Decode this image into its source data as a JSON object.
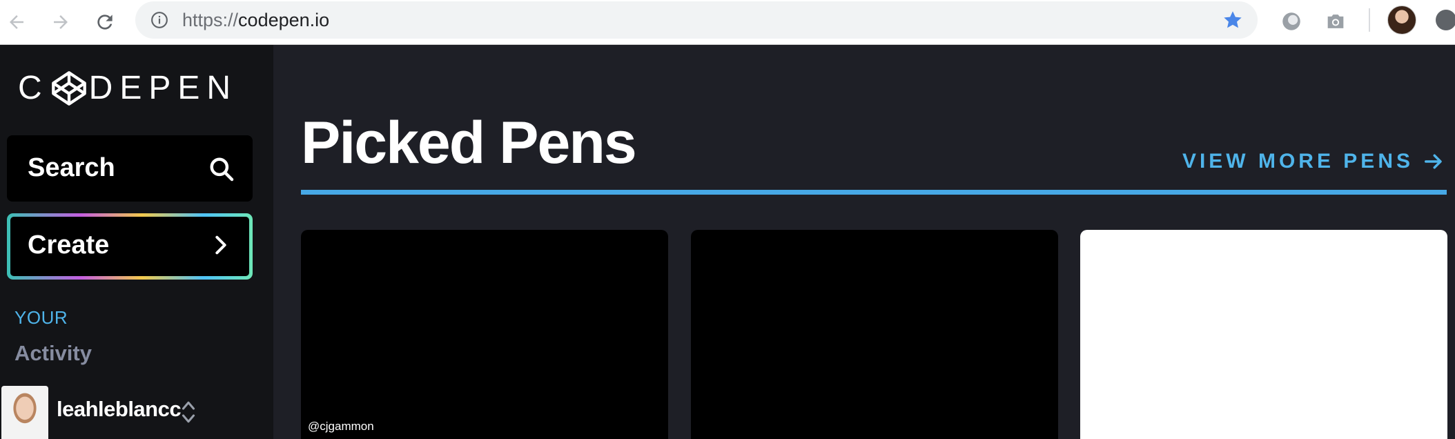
{
  "browser": {
    "url_scheme": "https://",
    "url_host": "codepen.io",
    "icons": [
      "back-icon",
      "forward-icon",
      "reload-icon",
      "info-icon",
      "star-icon",
      "extension-icon",
      "camera-icon",
      "profile-icon",
      "update-icon"
    ],
    "star_color": "#4a86e8"
  },
  "sidebar": {
    "logo_text_left": "C",
    "logo_text_right": "DEPEN",
    "search_label": "Search",
    "create_label": "Create",
    "section_label": "YOUR",
    "activity_label": "Activity",
    "username": "leahleblancc"
  },
  "main": {
    "title": "Picked Pens",
    "view_more": "VIEW MORE PENS",
    "accent_color": "#47a8e6",
    "cards": [
      {
        "author": "@cjgammon",
        "theme": "dark"
      },
      {
        "author": "",
        "theme": "dark"
      },
      {
        "author": "",
        "theme": "light"
      }
    ]
  }
}
